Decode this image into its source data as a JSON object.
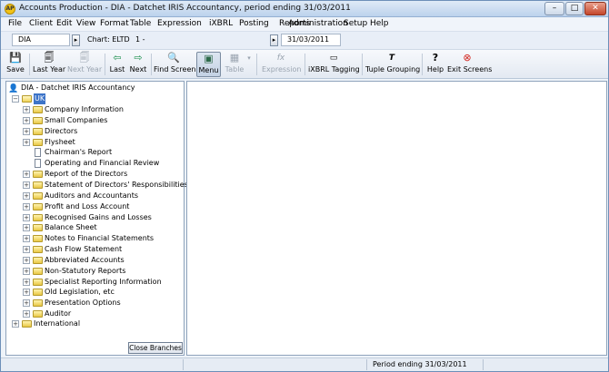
{
  "window": {
    "title": "Accounts Production - DIA - Datchet IRIS Accountancy, period ending 31/03/2011",
    "icon_text": "AP",
    "minimize": "–",
    "maximize": "□",
    "close": "✕"
  },
  "menu": [
    "File",
    "Client",
    "Edit",
    "View",
    "Format",
    "Table",
    "Expression",
    "iXBRL",
    "Posting",
    "Reports",
    "Administration",
    "Setup",
    "Help"
  ],
  "infobar": {
    "client_code": "DIA",
    "chart": "Chart: ELTD",
    "page_indicator": "1 -",
    "period_date": "31/03/2011"
  },
  "toolbar": [
    {
      "label": "Save",
      "icon": "save-icon",
      "enabled": true
    },
    {
      "label": "Last Year",
      "icon": "last-year-icon",
      "enabled": true
    },
    {
      "label": "Next Year",
      "icon": "next-year-icon",
      "enabled": false
    },
    {
      "label": "Last",
      "icon": "arrow-left-icon",
      "enabled": true
    },
    {
      "label": "Next",
      "icon": "arrow-right-icon",
      "enabled": true
    },
    {
      "label": "Find Screen",
      "icon": "magnifier-icon",
      "enabled": true
    },
    {
      "label": "Menu",
      "icon": "menu-icon",
      "enabled": true,
      "active": true
    },
    {
      "label": "Table",
      "icon": "table-icon",
      "enabled": false
    },
    {
      "label": "Expression",
      "icon": "fx-icon",
      "enabled": false
    },
    {
      "label": "iXBRL Tagging",
      "icon": "tag-icon",
      "enabled": true
    },
    {
      "label": "Tuple Grouping",
      "icon": "tuple-icon",
      "enabled": true
    },
    {
      "label": "Help",
      "icon": "help-icon",
      "enabled": true
    },
    {
      "label": "Exit Screens",
      "icon": "exit-icon",
      "enabled": true
    }
  ],
  "tree": {
    "root": "DIA - Datchet IRIS Accountancy",
    "uk": "UK",
    "items": [
      {
        "label": "Company Information",
        "type": "folder"
      },
      {
        "label": "Small Companies",
        "type": "folder"
      },
      {
        "label": "Directors",
        "type": "folder"
      },
      {
        "label": "Flysheet",
        "type": "folder"
      },
      {
        "label": "Chairman's Report",
        "type": "doc"
      },
      {
        "label": "Operating and Financial Review",
        "type": "doc"
      },
      {
        "label": "Report of the Directors",
        "type": "folder"
      },
      {
        "label": "Statement of Directors' Responsibilities",
        "type": "folder"
      },
      {
        "label": "Auditors and Accountants",
        "type": "folder"
      },
      {
        "label": "Profit and Loss Account",
        "type": "folder"
      },
      {
        "label": "Recognised Gains and Losses",
        "type": "folder"
      },
      {
        "label": "Balance Sheet",
        "type": "folder"
      },
      {
        "label": "Notes to Financial Statements",
        "type": "folder"
      },
      {
        "label": "Cash Flow Statement",
        "type": "folder"
      },
      {
        "label": "Abbreviated Accounts",
        "type": "folder"
      },
      {
        "label": "Non-Statutory Reports",
        "type": "folder"
      },
      {
        "label": "Specialist Reporting Information",
        "type": "folder"
      },
      {
        "label": "Old Legislation, etc",
        "type": "folder"
      },
      {
        "label": "Presentation Options",
        "type": "folder"
      },
      {
        "label": "Auditor",
        "type": "folder"
      }
    ],
    "international": "International",
    "close_branches": "Close Branches"
  },
  "status": {
    "period": "Period ending 31/03/2011"
  }
}
